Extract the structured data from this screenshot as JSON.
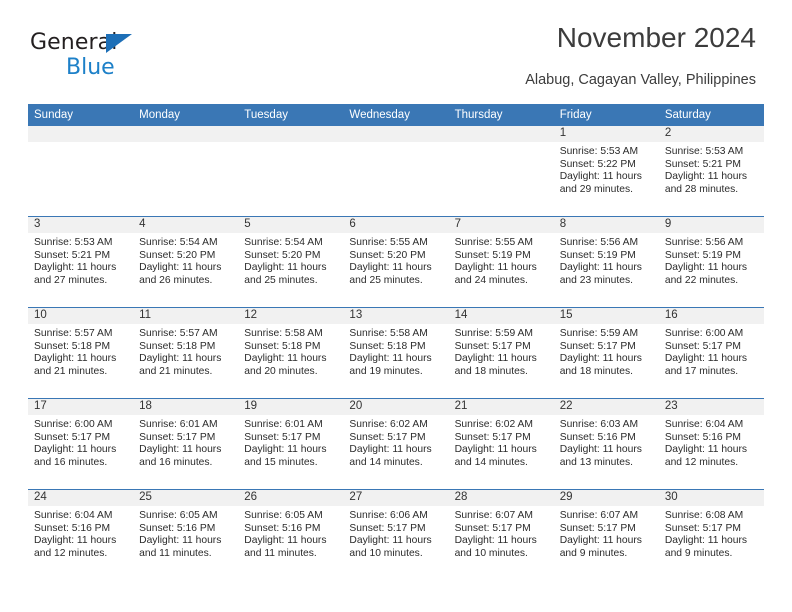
{
  "logo": {
    "word_top": "General",
    "word_bottom": "Blue",
    "triangle_color": "#1d6fb7",
    "blue_color": "#1d80c8"
  },
  "header": {
    "title": "November 2024",
    "subtitle": "Alabug, Cagayan Valley, Philippines"
  },
  "theme": {
    "header_blue": "#3a77b5",
    "date_strip_gray": "#f1f1f1",
    "text": "#2b2b2b"
  },
  "calendar": {
    "weekdays": [
      "Sunday",
      "Monday",
      "Tuesday",
      "Wednesday",
      "Thursday",
      "Friday",
      "Saturday"
    ],
    "weeks": [
      [
        {
          "day": "",
          "sunrise": "",
          "sunset": "",
          "daylight": "",
          "daylight2": ""
        },
        {
          "day": "",
          "sunrise": "",
          "sunset": "",
          "daylight": "",
          "daylight2": ""
        },
        {
          "day": "",
          "sunrise": "",
          "sunset": "",
          "daylight": "",
          "daylight2": ""
        },
        {
          "day": "",
          "sunrise": "",
          "sunset": "",
          "daylight": "",
          "daylight2": ""
        },
        {
          "day": "",
          "sunrise": "",
          "sunset": "",
          "daylight": "",
          "daylight2": ""
        },
        {
          "day": "1",
          "sunrise": "Sunrise: 5:53 AM",
          "sunset": "Sunset: 5:22 PM",
          "daylight": "Daylight: 11 hours",
          "daylight2": "and 29 minutes."
        },
        {
          "day": "2",
          "sunrise": "Sunrise: 5:53 AM",
          "sunset": "Sunset: 5:21 PM",
          "daylight": "Daylight: 11 hours",
          "daylight2": "and 28 minutes."
        }
      ],
      [
        {
          "day": "3",
          "sunrise": "Sunrise: 5:53 AM",
          "sunset": "Sunset: 5:21 PM",
          "daylight": "Daylight: 11 hours",
          "daylight2": "and 27 minutes."
        },
        {
          "day": "4",
          "sunrise": "Sunrise: 5:54 AM",
          "sunset": "Sunset: 5:20 PM",
          "daylight": "Daylight: 11 hours",
          "daylight2": "and 26 minutes."
        },
        {
          "day": "5",
          "sunrise": "Sunrise: 5:54 AM",
          "sunset": "Sunset: 5:20 PM",
          "daylight": "Daylight: 11 hours",
          "daylight2": "and 25 minutes."
        },
        {
          "day": "6",
          "sunrise": "Sunrise: 5:55 AM",
          "sunset": "Sunset: 5:20 PM",
          "daylight": "Daylight: 11 hours",
          "daylight2": "and 25 minutes."
        },
        {
          "day": "7",
          "sunrise": "Sunrise: 5:55 AM",
          "sunset": "Sunset: 5:19 PM",
          "daylight": "Daylight: 11 hours",
          "daylight2": "and 24 minutes."
        },
        {
          "day": "8",
          "sunrise": "Sunrise: 5:56 AM",
          "sunset": "Sunset: 5:19 PM",
          "daylight": "Daylight: 11 hours",
          "daylight2": "and 23 minutes."
        },
        {
          "day": "9",
          "sunrise": "Sunrise: 5:56 AM",
          "sunset": "Sunset: 5:19 PM",
          "daylight": "Daylight: 11 hours",
          "daylight2": "and 22 minutes."
        }
      ],
      [
        {
          "day": "10",
          "sunrise": "Sunrise: 5:57 AM",
          "sunset": "Sunset: 5:18 PM",
          "daylight": "Daylight: 11 hours",
          "daylight2": "and 21 minutes."
        },
        {
          "day": "11",
          "sunrise": "Sunrise: 5:57 AM",
          "sunset": "Sunset: 5:18 PM",
          "daylight": "Daylight: 11 hours",
          "daylight2": "and 21 minutes."
        },
        {
          "day": "12",
          "sunrise": "Sunrise: 5:58 AM",
          "sunset": "Sunset: 5:18 PM",
          "daylight": "Daylight: 11 hours",
          "daylight2": "and 20 minutes."
        },
        {
          "day": "13",
          "sunrise": "Sunrise: 5:58 AM",
          "sunset": "Sunset: 5:18 PM",
          "daylight": "Daylight: 11 hours",
          "daylight2": "and 19 minutes."
        },
        {
          "day": "14",
          "sunrise": "Sunrise: 5:59 AM",
          "sunset": "Sunset: 5:17 PM",
          "daylight": "Daylight: 11 hours",
          "daylight2": "and 18 minutes."
        },
        {
          "day": "15",
          "sunrise": "Sunrise: 5:59 AM",
          "sunset": "Sunset: 5:17 PM",
          "daylight": "Daylight: 11 hours",
          "daylight2": "and 18 minutes."
        },
        {
          "day": "16",
          "sunrise": "Sunrise: 6:00 AM",
          "sunset": "Sunset: 5:17 PM",
          "daylight": "Daylight: 11 hours",
          "daylight2": "and 17 minutes."
        }
      ],
      [
        {
          "day": "17",
          "sunrise": "Sunrise: 6:00 AM",
          "sunset": "Sunset: 5:17 PM",
          "daylight": "Daylight: 11 hours",
          "daylight2": "and 16 minutes."
        },
        {
          "day": "18",
          "sunrise": "Sunrise: 6:01 AM",
          "sunset": "Sunset: 5:17 PM",
          "daylight": "Daylight: 11 hours",
          "daylight2": "and 16 minutes."
        },
        {
          "day": "19",
          "sunrise": "Sunrise: 6:01 AM",
          "sunset": "Sunset: 5:17 PM",
          "daylight": "Daylight: 11 hours",
          "daylight2": "and 15 minutes."
        },
        {
          "day": "20",
          "sunrise": "Sunrise: 6:02 AM",
          "sunset": "Sunset: 5:17 PM",
          "daylight": "Daylight: 11 hours",
          "daylight2": "and 14 minutes."
        },
        {
          "day": "21",
          "sunrise": "Sunrise: 6:02 AM",
          "sunset": "Sunset: 5:17 PM",
          "daylight": "Daylight: 11 hours",
          "daylight2": "and 14 minutes."
        },
        {
          "day": "22",
          "sunrise": "Sunrise: 6:03 AM",
          "sunset": "Sunset: 5:16 PM",
          "daylight": "Daylight: 11 hours",
          "daylight2": "and 13 minutes."
        },
        {
          "day": "23",
          "sunrise": "Sunrise: 6:04 AM",
          "sunset": "Sunset: 5:16 PM",
          "daylight": "Daylight: 11 hours",
          "daylight2": "and 12 minutes."
        }
      ],
      [
        {
          "day": "24",
          "sunrise": "Sunrise: 6:04 AM",
          "sunset": "Sunset: 5:16 PM",
          "daylight": "Daylight: 11 hours",
          "daylight2": "and 12 minutes."
        },
        {
          "day": "25",
          "sunrise": "Sunrise: 6:05 AM",
          "sunset": "Sunset: 5:16 PM",
          "daylight": "Daylight: 11 hours",
          "daylight2": "and 11 minutes."
        },
        {
          "day": "26",
          "sunrise": "Sunrise: 6:05 AM",
          "sunset": "Sunset: 5:16 PM",
          "daylight": "Daylight: 11 hours",
          "daylight2": "and 11 minutes."
        },
        {
          "day": "27",
          "sunrise": "Sunrise: 6:06 AM",
          "sunset": "Sunset: 5:17 PM",
          "daylight": "Daylight: 11 hours",
          "daylight2": "and 10 minutes."
        },
        {
          "day": "28",
          "sunrise": "Sunrise: 6:07 AM",
          "sunset": "Sunset: 5:17 PM",
          "daylight": "Daylight: 11 hours",
          "daylight2": "and 10 minutes."
        },
        {
          "day": "29",
          "sunrise": "Sunrise: 6:07 AM",
          "sunset": "Sunset: 5:17 PM",
          "daylight": "Daylight: 11 hours",
          "daylight2": "and 9 minutes."
        },
        {
          "day": "30",
          "sunrise": "Sunrise: 6:08 AM",
          "sunset": "Sunset: 5:17 PM",
          "daylight": "Daylight: 11 hours",
          "daylight2": "and 9 minutes."
        }
      ]
    ]
  }
}
